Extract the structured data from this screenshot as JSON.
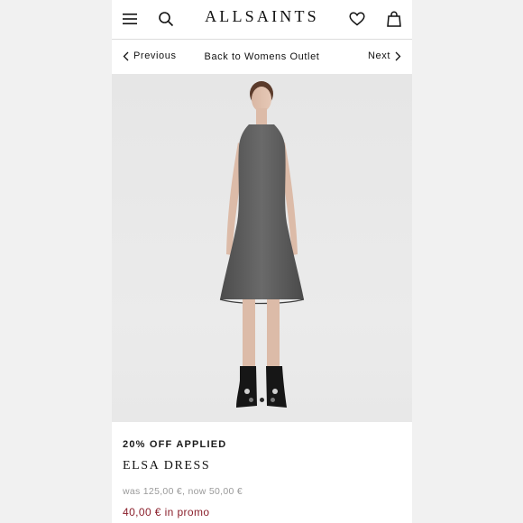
{
  "header": {
    "brand": "ALLSAINTS",
    "icons": [
      "menu-icon",
      "search-icon",
      "heart-icon",
      "bag-icon"
    ]
  },
  "nav": {
    "previous_label": "Previous",
    "back_label": "Back to Womens Outlet",
    "next_label": "Next"
  },
  "gallery": {
    "slide_count": 3,
    "active_slide": 2
  },
  "product": {
    "promo_flag": "20% OFF APPLIED",
    "name": "ELSA DRESS",
    "price_was_now": "was 125,00 €, now 50,00 €",
    "promo_price": "40,00 € in promo"
  },
  "colors": {
    "promo_price": "#8a1f2b",
    "old_price": "#9a9a9a",
    "page_background": "#f1f1f1"
  }
}
